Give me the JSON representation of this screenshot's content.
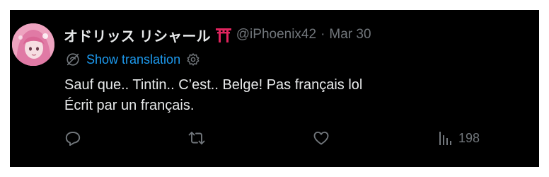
{
  "tweet": {
    "author": {
      "display_name": "オドリッス リシャール",
      "emoji_icon": "torii-gate-icon",
      "handle": "@iPhoenix42",
      "separator": "·",
      "date": "Mar 30"
    },
    "translate": {
      "label": "Show translation",
      "icon": "translate-icon",
      "settings_icon": "gear-icon"
    },
    "text_lines": [
      "Sauf que.. Tintin.. C’est.. Belge! Pas français lol",
      "Écrit par un français."
    ],
    "actions": {
      "reply_icon": "reply-icon",
      "retweet_icon": "retweet-icon",
      "like_icon": "like-icon",
      "views_icon": "views-icon",
      "views_count": "198"
    },
    "colors": {
      "background": "#000000",
      "text": "#e7e9ea",
      "muted": "#71767b",
      "link": "#1d9bf0",
      "torii": "#e0245e"
    }
  }
}
